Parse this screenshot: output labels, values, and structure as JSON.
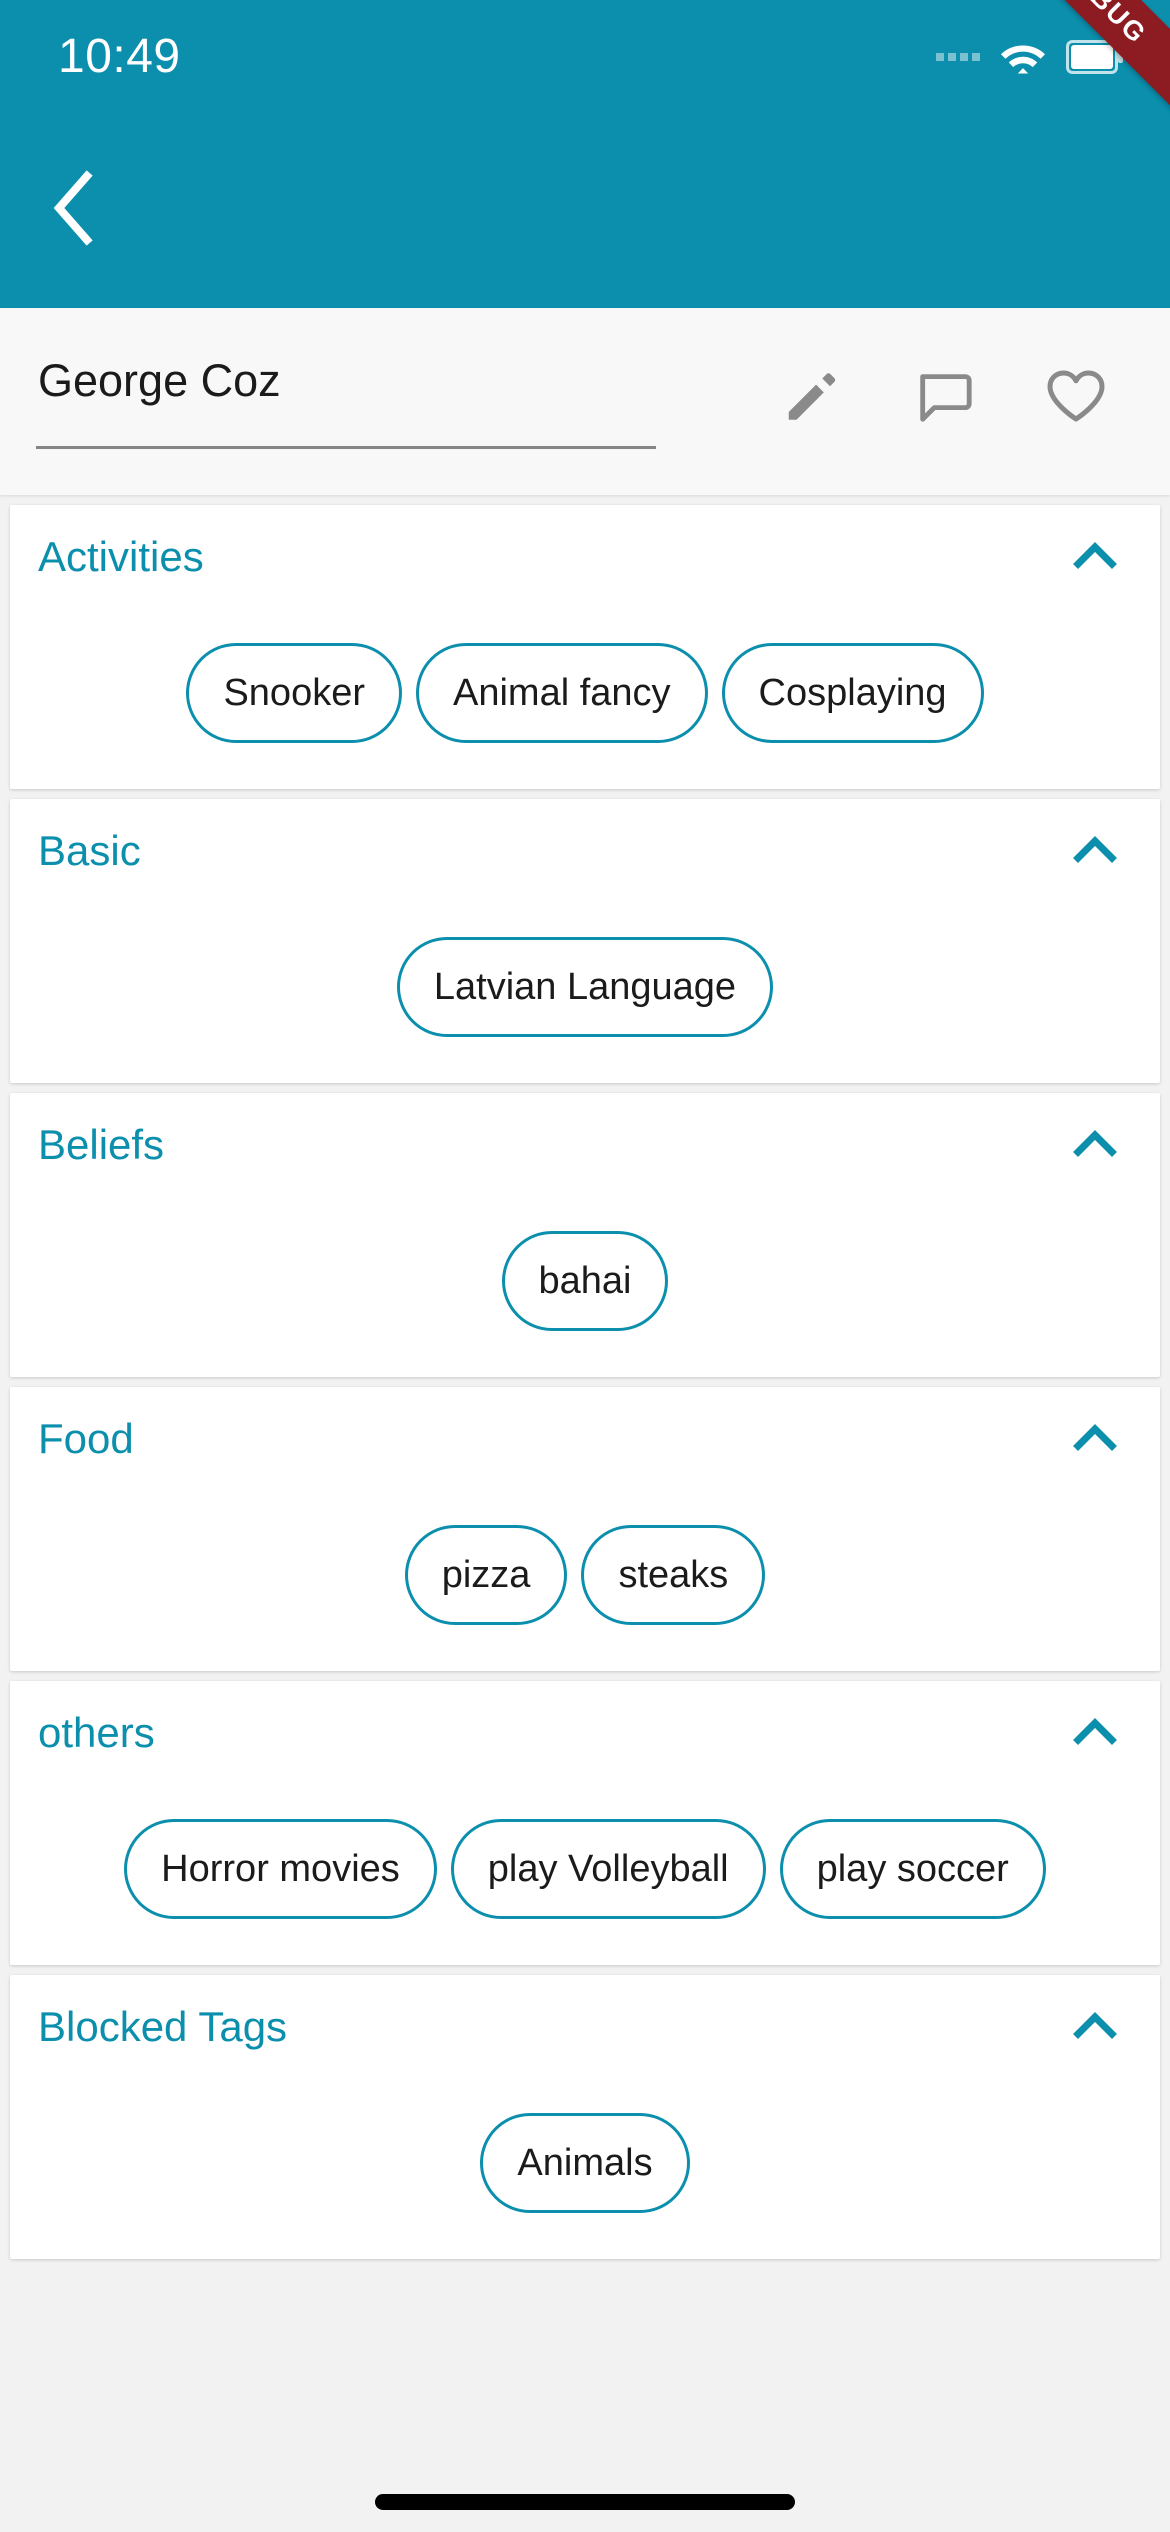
{
  "colors": {
    "accent": "#0c8fad",
    "appbar": "#0c8fad",
    "debug_banner": "#8d1b22",
    "chip_border": "#0c8fad",
    "icon_gray": "#8a8a8a",
    "page_bg": "#f2f2f2"
  },
  "status_bar": {
    "time": "10:49",
    "signal_icon": "signal-dots-icon",
    "wifi_icon": "wifi-icon",
    "battery_icon": "battery-icon",
    "debug_label": "DEBUG"
  },
  "app_bar": {
    "back_icon": "chevron-left-icon"
  },
  "profile": {
    "name": "George Coz",
    "actions": [
      {
        "name": "edit-profile-button",
        "icon": "pencil-icon"
      },
      {
        "name": "message-button",
        "icon": "chat-bubble-icon"
      },
      {
        "name": "favorite-button",
        "icon": "heart-icon"
      }
    ]
  },
  "sections": [
    {
      "title": "Activities",
      "collapse_icon": "chevron-up-icon",
      "expanded": true,
      "chips": [
        "Snooker",
        "Animal fancy",
        "Cosplaying"
      ]
    },
    {
      "title": "Basic",
      "collapse_icon": "chevron-up-icon",
      "expanded": true,
      "chips": [
        "Latvian Language"
      ]
    },
    {
      "title": "Beliefs",
      "collapse_icon": "chevron-up-icon",
      "expanded": true,
      "chips": [
        "bahai"
      ]
    },
    {
      "title": "Food",
      "collapse_icon": "chevron-up-icon",
      "expanded": true,
      "chips": [
        "pizza",
        "steaks"
      ]
    },
    {
      "title": "others",
      "collapse_icon": "chevron-up-icon",
      "expanded": true,
      "chips": [
        "Horror movies",
        "play Volleyball",
        "play soccer"
      ]
    },
    {
      "title": "Blocked Tags",
      "collapse_icon": "chevron-up-icon",
      "expanded": true,
      "chips": [
        "Animals"
      ]
    }
  ]
}
